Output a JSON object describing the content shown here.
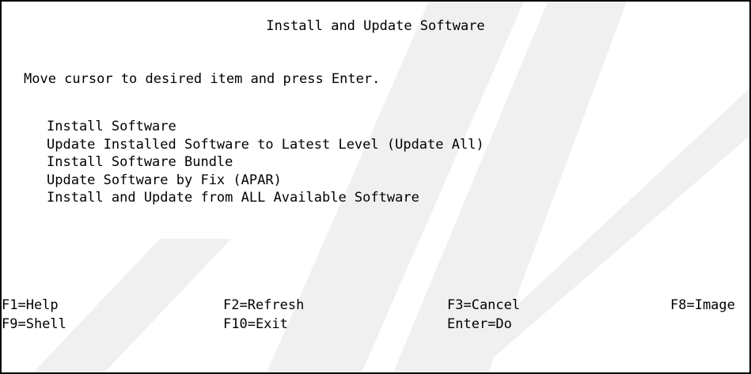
{
  "screen": {
    "title": "Install and Update Software",
    "instruction": "Move cursor to desired item and press Enter."
  },
  "menu": {
    "items": [
      {
        "label": "Install Software"
      },
      {
        "label": "Update Installed Software to Latest Level (Update All)"
      },
      {
        "label": "Install Software Bundle"
      },
      {
        "label": "Update Software by Fix (APAR)"
      },
      {
        "label": "Install and Update from ALL Available Software"
      }
    ]
  },
  "function_keys": {
    "help": "F1=Help",
    "refresh": "F2=Refresh",
    "cancel": "F3=Cancel",
    "image": "F8=Image",
    "shell": "F9=Shell",
    "exit": "F10=Exit",
    "do": "Enter=Do"
  },
  "colors": {
    "text": "#000000",
    "background": "#ffffff",
    "watermark": "#f0f0f0"
  },
  "watermark_icon": "diagonal-stripes"
}
